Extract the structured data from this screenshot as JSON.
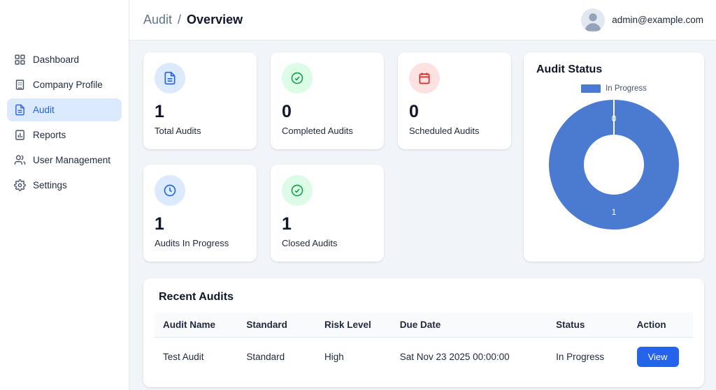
{
  "sidebar": {
    "items": [
      {
        "label": "Dashboard",
        "active": false
      },
      {
        "label": "Company Profile",
        "active": false
      },
      {
        "label": "Audit",
        "active": true
      },
      {
        "label": "Reports",
        "active": false
      },
      {
        "label": "User Management",
        "active": false
      },
      {
        "label": "Settings",
        "active": false
      }
    ]
  },
  "header": {
    "breadcrumb": {
      "section": "Audit",
      "separator": "/",
      "current": "Overview"
    },
    "user_email": "admin@example.com"
  },
  "stats": {
    "cards": [
      {
        "value": "1",
        "label": "Total Audits",
        "icon": "document-icon",
        "color": "#2563eb"
      },
      {
        "value": "0",
        "label": "Completed Audits",
        "icon": "check-circle-icon",
        "color": "#16a34a"
      },
      {
        "value": "0",
        "label": "Scheduled Audits",
        "icon": "calendar-icon",
        "color": "#dc2626"
      },
      {
        "value": "1",
        "label": "Audits In Progress",
        "icon": "clock-icon",
        "color": "#2563eb"
      },
      {
        "value": "1",
        "label": "Closed Audits",
        "icon": "check-circle-icon",
        "color": "#16a34a"
      }
    ]
  },
  "audit_status": {
    "title": "Audit Status",
    "chart_data": {
      "type": "pie",
      "style": "donut",
      "labels": [
        "In Progress"
      ],
      "values": [
        1
      ],
      "data_labels": {
        "top": "0",
        "bottom": "1"
      },
      "color": "#4a7bd0",
      "legend_position": "top"
    }
  },
  "recent_audits": {
    "title": "Recent Audits",
    "columns": [
      "Audit Name",
      "Standard",
      "Risk Level",
      "Due Date",
      "Status",
      "Action"
    ],
    "rows": [
      {
        "name": "Test Audit",
        "standard": "Standard",
        "risk": "High",
        "due": "Sat Nov 23 2025 00:00:00",
        "status": "In Progress",
        "action": "View"
      }
    ]
  },
  "colors": {
    "accent": "#2563eb",
    "active_nav_bg": "#dbeafe",
    "chart_blue": "#4a7bd0"
  }
}
